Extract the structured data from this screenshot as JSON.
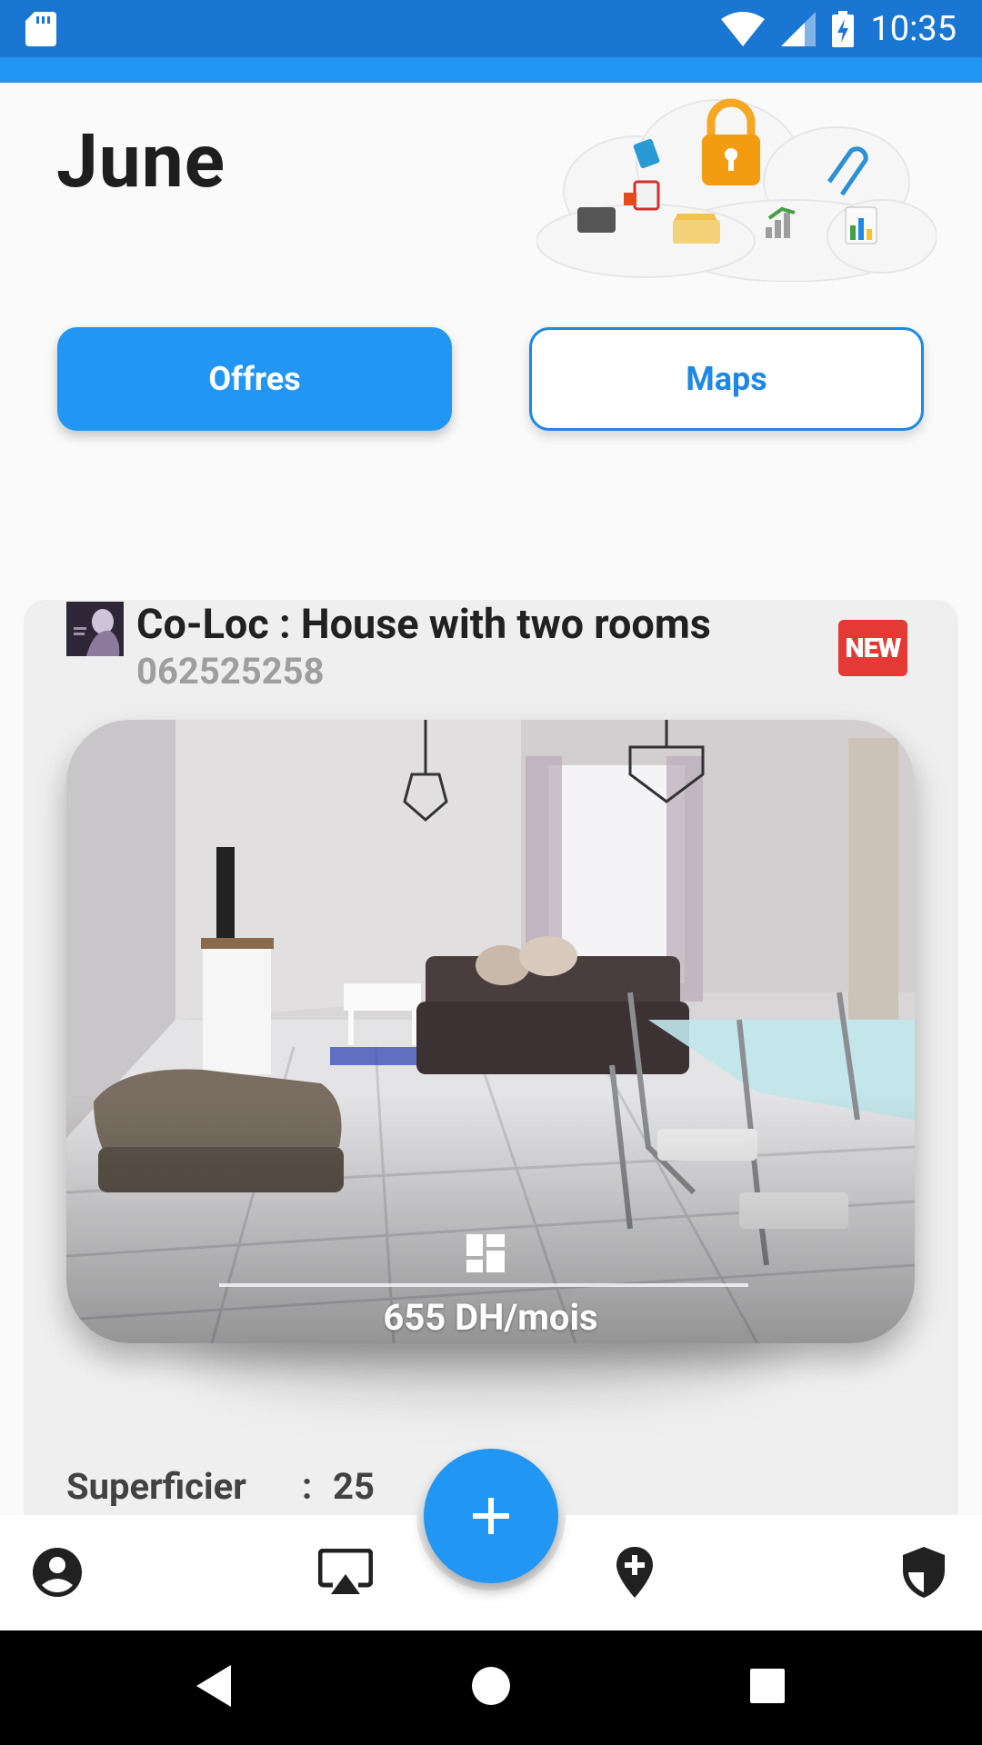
{
  "status_bar": {
    "time": "10:35",
    "icons": [
      "sd-card-icon",
      "wifi-icon",
      "signal-icon",
      "battery-charging-icon"
    ]
  },
  "header": {
    "title": "June",
    "illustration": "cloud-storage-illustration"
  },
  "tabs": {
    "offres_label": "Offres",
    "maps_label": "Maps",
    "active": "Offres"
  },
  "listing": {
    "title": "Co-Loc : House with two rooms",
    "phone": "062525258",
    "badge": "NEW",
    "price": "655 DH/mois",
    "spec_label": "Superficier",
    "spec_separator": ":",
    "spec_value": "25"
  },
  "bottom_nav": {
    "items": [
      "account-icon",
      "airplay-icon",
      "add-location-icon",
      "shield-icon"
    ],
    "fab": "add-icon"
  },
  "colors": {
    "status_bar": "#1976d2",
    "primary": "#2196f3",
    "badge": "#e53935"
  }
}
